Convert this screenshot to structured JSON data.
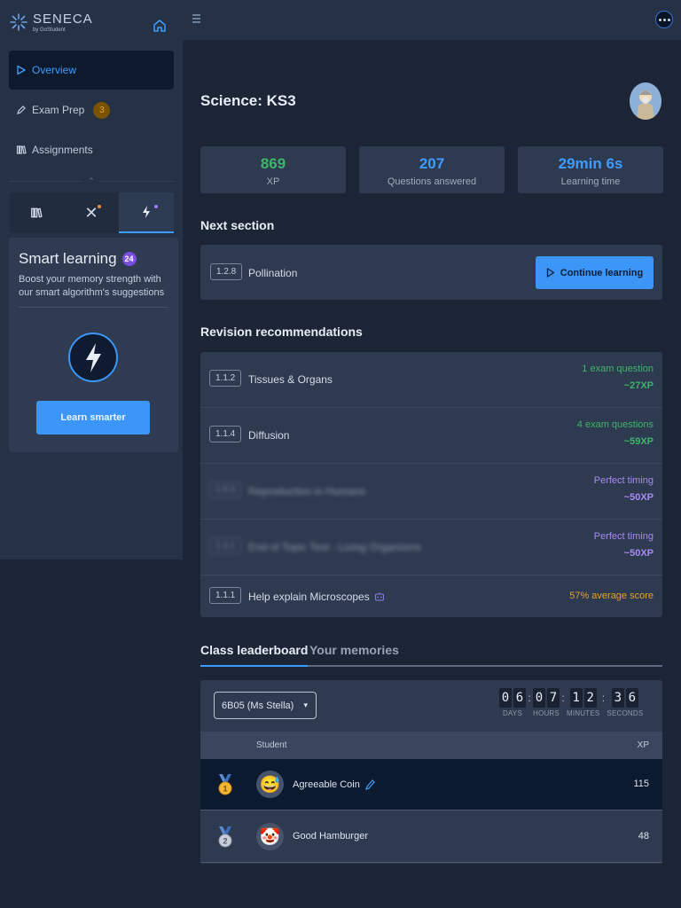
{
  "brand": {
    "name": "SENECA",
    "tagline": "by GoStudent"
  },
  "sidebar": {
    "items": [
      {
        "label": "Overview",
        "icon": "play-outline-icon"
      },
      {
        "label": "Exam Prep",
        "icon": "pencil-icon",
        "badge": "3"
      },
      {
        "label": "Assignments",
        "icon": "books-icon"
      }
    ],
    "tabs": [
      {
        "icon": "books-icon"
      },
      {
        "icon": "close-icon",
        "dot_color": "#f08a3c"
      },
      {
        "icon": "lightning-icon",
        "dot_color": "#a67cff"
      }
    ],
    "smart_learning": {
      "title": "Smart learning",
      "count": "24",
      "description": "Boost your memory strength with our smart algorithm's suggestions",
      "button": "Learn smarter"
    }
  },
  "page": {
    "title": "Science: KS3"
  },
  "stats": [
    {
      "value": "869",
      "label": "XP",
      "color": "#3fb56a"
    },
    {
      "value": "207",
      "label": "Questions answered",
      "color": "#3f9cff"
    },
    {
      "value": "29min 6s",
      "label": "Learning time",
      "color": "#3f9cff"
    }
  ],
  "next_section": {
    "heading": "Next section",
    "code": "1.2.8",
    "label": "Pollination",
    "button": "Continue learning"
  },
  "revision": {
    "heading": "Revision recommendations",
    "items": [
      {
        "code": "1.1.2",
        "label": "Tissues & Organs",
        "note": "1 exam question",
        "xp": "~27XP",
        "color": "#3fb56a"
      },
      {
        "code": "1.1.4",
        "label": "Diffusion",
        "note": "4 exam questions",
        "xp": "~59XP",
        "color": "#3fb56a"
      },
      {
        "code": "1.5.3",
        "label": "Reproduction in Humans",
        "note": "Perfect timing",
        "xp": "~50XP",
        "color": "#a88af5"
      },
      {
        "code": "1.2.1",
        "label": "End of Topic Test - Living Organisms",
        "note": "Perfect timing",
        "xp": "~50XP",
        "color": "#a88af5"
      },
      {
        "code": "1.1.1",
        "label": "Help explain Microscopes",
        "note": "57% average score",
        "color": "#e5a12b"
      }
    ]
  },
  "leaderboard": {
    "tabs": [
      "Class leaderboard",
      "Your memories"
    ],
    "class_select": "6B05 (Ms Stella)",
    "timer": {
      "days": "06",
      "hours": "07",
      "minutes": "12",
      "seconds": "36",
      "labels": [
        "DAYS",
        "HOURS",
        "MINUTES",
        "SECONDS"
      ]
    },
    "columns": {
      "student": "Student",
      "xp": "XP"
    },
    "rows": [
      {
        "rank": "1",
        "name": "Agreeable Coin",
        "xp": "115",
        "avatar": "😅"
      },
      {
        "rank": "2",
        "name": "Good Hamburger",
        "xp": "48",
        "avatar": "🤡"
      }
    ]
  }
}
